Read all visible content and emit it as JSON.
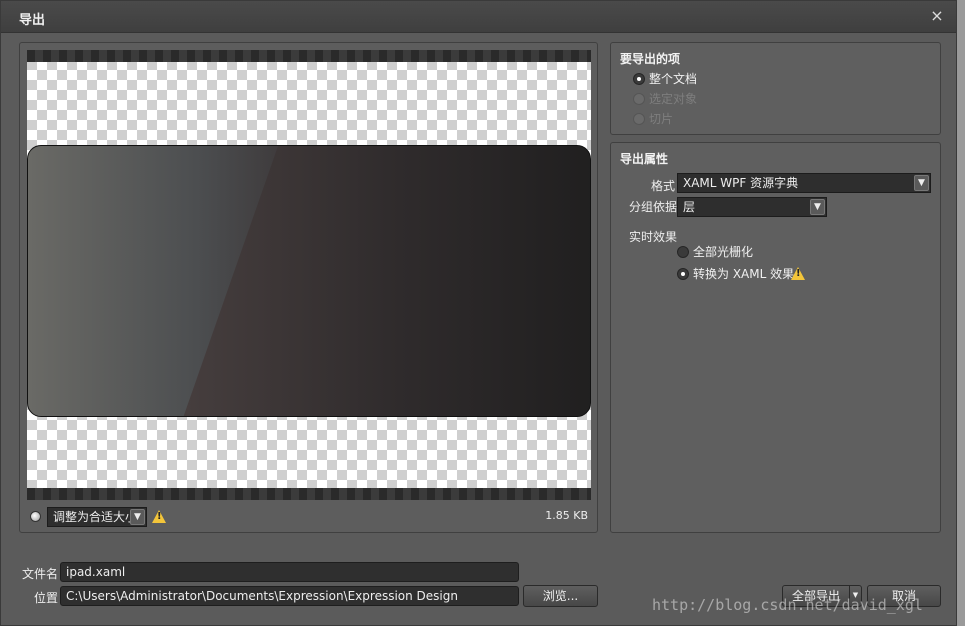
{
  "window": {
    "title": "导出",
    "close_glyph": "×"
  },
  "preview": {
    "zoom_select": "调整为合适大小",
    "warning_glyph": "!",
    "file_size": "1.85 KB"
  },
  "export_items": {
    "title": "要导出的项",
    "options": [
      {
        "label": "整个文档",
        "checked": true,
        "disabled": false
      },
      {
        "label": "选定对象",
        "checked": false,
        "disabled": true
      },
      {
        "label": "切片",
        "checked": false,
        "disabled": true
      }
    ]
  },
  "export_props": {
    "title": "导出属性",
    "format_label": "格式",
    "format_value": "XAML WPF 资源字典",
    "group_label": "分组依据",
    "group_value": "层",
    "effects_label": "实时效果",
    "effects_options": [
      {
        "label": "全部光栅化",
        "checked": false
      },
      {
        "label": "转换为 XAML 效果",
        "checked": true
      }
    ]
  },
  "file": {
    "name_label": "文件名",
    "name_value": "ipad.xaml",
    "location_label": "位置",
    "location_value": "C:\\Users\\Administrator\\Documents\\Expression\\Expression Design",
    "browse_label": "浏览..."
  },
  "buttons": {
    "export_all": "全部导出",
    "cancel": "取消"
  },
  "watermark": "http://blog.csdn.net/david_xgl"
}
